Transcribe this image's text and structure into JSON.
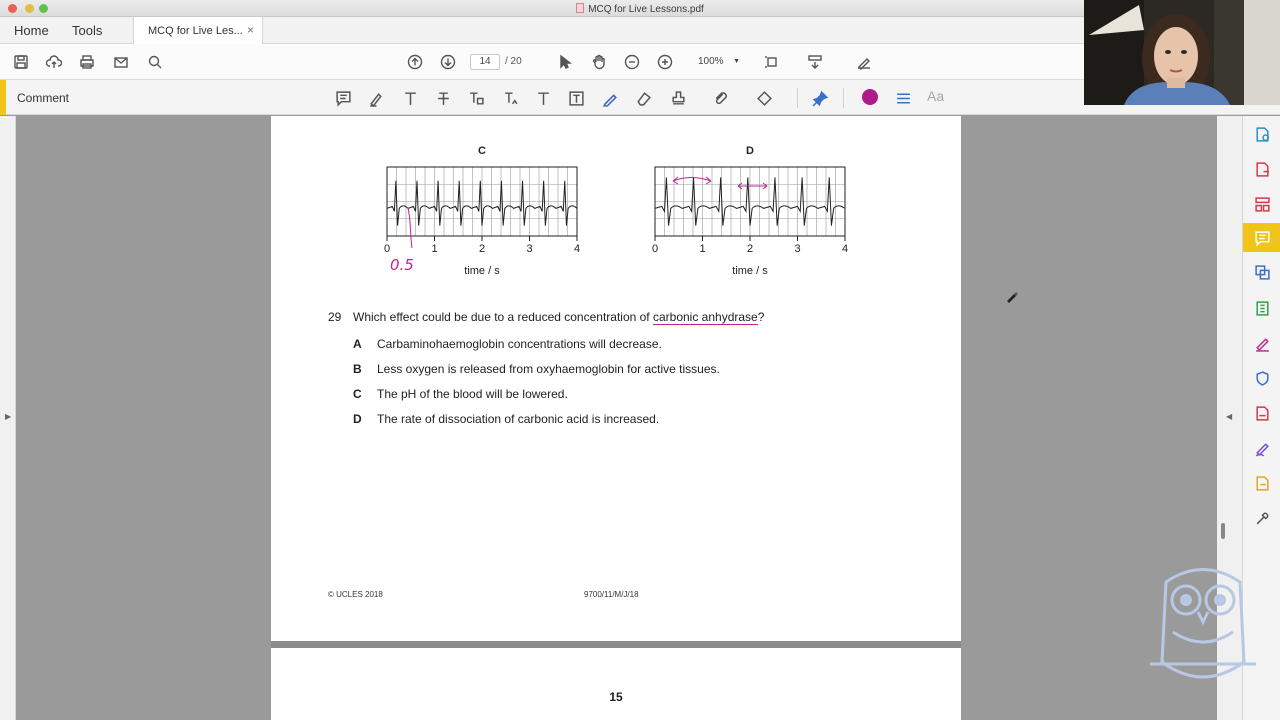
{
  "window": {
    "title": "MCQ for Live Lessons.pdf"
  },
  "tabs": {
    "home": "Home",
    "tools": "Tools",
    "doc": "MCQ for Live Les...",
    "close": "×"
  },
  "toolbar": {
    "page_current": "14",
    "page_total": "/ 20",
    "zoom": "100%"
  },
  "comment_bar": {
    "label": "Comment",
    "text_style_label": "Aa",
    "active_color": "#b0198c"
  },
  "chart_data": [
    {
      "type": "line",
      "title": "C",
      "xlabel": "time / s",
      "xticks": [
        "0",
        "1",
        "2",
        "3",
        "4"
      ],
      "xlim": [
        0,
        4
      ],
      "annotation": "0.5"
    },
    {
      "type": "line",
      "title": "D",
      "xlabel": "time / s",
      "xticks": [
        "0",
        "1",
        "2",
        "3",
        "4"
      ],
      "xlim": [
        0,
        4
      ]
    }
  ],
  "question": {
    "number": "29",
    "text_before": "Which effect could be due to a reduced concentration of ",
    "text_underlined": "carbonic anhydrase",
    "text_after": "?",
    "options": [
      {
        "letter": "A",
        "text": "Carbaminohaemoglobin concentrations will decrease."
      },
      {
        "letter": "B",
        "text": "Less oxygen is released from oxyhaemoglobin for active tissues."
      },
      {
        "letter": "C",
        "text": "The pH of the blood will be lowered."
      },
      {
        "letter": "D",
        "text": "The rate of dissociation of carbonic acid is increased."
      }
    ]
  },
  "footer": {
    "copyright": "© UCLES 2018",
    "code": "9700/11/M/J/18"
  },
  "next_page": {
    "number": "15"
  },
  "colors": {
    "annotation": "#c0268f",
    "accent": "#f0c419"
  }
}
